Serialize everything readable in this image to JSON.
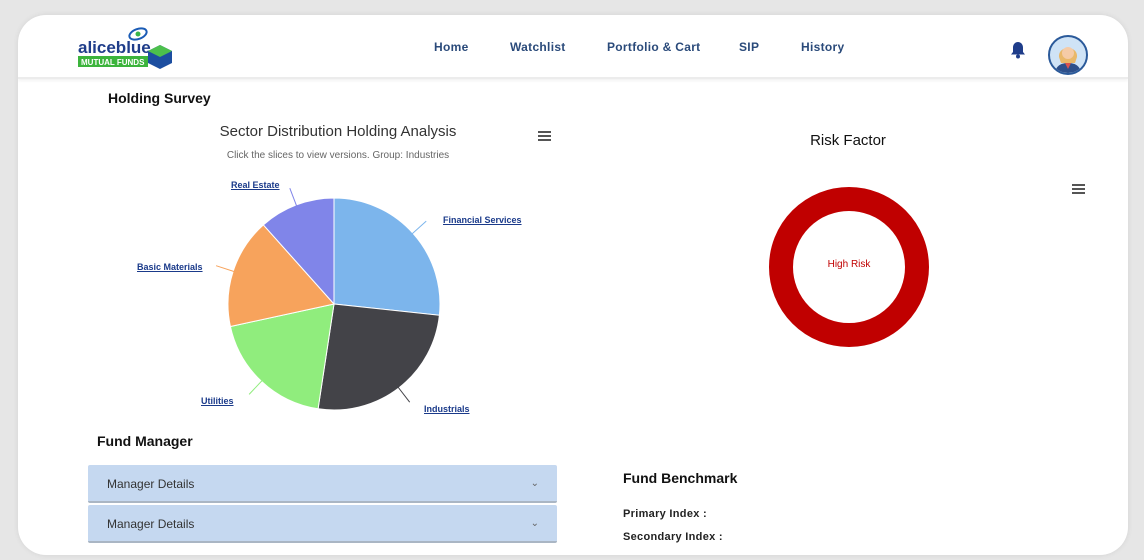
{
  "header": {
    "logo_text": "aliceblue",
    "logo_sub": "MUTUAL FUNDS",
    "nav": [
      "Home",
      "Watchlist",
      "Portfolio & Cart",
      "SIP",
      "History"
    ],
    "icons": [
      "bell-icon",
      "avatar"
    ]
  },
  "holding": {
    "title": "Holding Survey"
  },
  "chart_data": {
    "type": "pie",
    "title": "Sector Distribution Holding Analysis",
    "subtitle": "Click the slices to view versions. Group: Industries",
    "categories": [
      "Financial Services",
      "Industrials",
      "Utilities",
      "Basic Materials",
      "Real Estate"
    ],
    "values": [
      26.7,
      25.7,
      19.2,
      16.8,
      11.6
    ],
    "colors": [
      "#7cb5ec",
      "#434348",
      "#90ed7d",
      "#f7a35c",
      "#8085e9"
    ]
  },
  "risk": {
    "title": "Risk Factor",
    "label": "High Risk",
    "color": "#c00000"
  },
  "fund_manager": {
    "title": "Fund Manager",
    "items": [
      "Manager Details",
      "Manager Details"
    ]
  },
  "benchmark": {
    "title": "Fund Benchmark",
    "primary": "Primary Index :",
    "secondary": "Secondary Index :"
  }
}
